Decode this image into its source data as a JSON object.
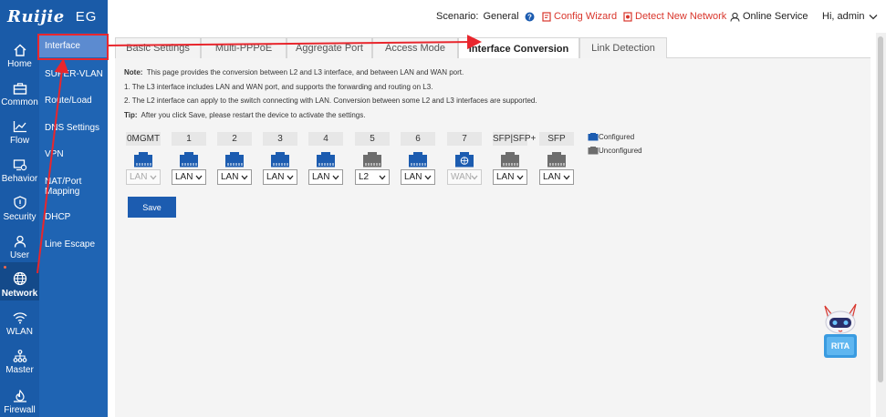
{
  "app": {
    "brand": "Ruijie",
    "product": "EG"
  },
  "topbar": {
    "scenario_label": "Scenario:",
    "scenario_value": "General",
    "config_wizard": "Config Wizard",
    "detect_network": "Detect New Network",
    "online_service": "Online Service",
    "user_greeting": "Hi, admin"
  },
  "nav": [
    {
      "label": "Home",
      "icon": "home-icon"
    },
    {
      "label": "Common",
      "icon": "briefcase-icon"
    },
    {
      "label": "Flow",
      "icon": "flow-chart-icon"
    },
    {
      "label": "Behavior",
      "icon": "behavior-icon"
    },
    {
      "label": "Security",
      "icon": "shield-icon"
    },
    {
      "label": "User",
      "icon": "user-icon"
    },
    {
      "label": "Network",
      "icon": "globe-icon"
    },
    {
      "label": "WLAN",
      "icon": "wifi-icon"
    },
    {
      "label": "Master",
      "icon": "hierarchy-icon"
    },
    {
      "label": "Firewall",
      "icon": "firewall-icon"
    }
  ],
  "subnav": [
    {
      "label": "Interface"
    },
    {
      "label": "SUPER-VLAN"
    },
    {
      "label": "Route/Load"
    },
    {
      "label": "DNS Settings"
    },
    {
      "label": "VPN"
    },
    {
      "label": "NAT/Port Mapping"
    },
    {
      "label": "DHCP"
    },
    {
      "label": "Line Escape"
    }
  ],
  "tabs": [
    {
      "label": "Basic Settings"
    },
    {
      "label": "Multi-PPPoE"
    },
    {
      "label": "Aggregate Port"
    },
    {
      "label": "Access Mode"
    },
    {
      "label": "Interface Conversion"
    },
    {
      "label": "Link Detection"
    }
  ],
  "note": {
    "line1_bold": "Note:",
    "line1": "This page provides the conversion between L2 and L3 interface, and between LAN and WAN port.",
    "line2": "1. The L3 interface includes LAN and WAN port, and supports the forwarding and routing on L3.",
    "line3": "2. The L2 interface can apply to the switch connecting with LAN. Conversion between some L2 and L3 interfaces are supported.",
    "line4_bold": "Tip:",
    "line4": "After you click Save, please restart the device to activate the settings."
  },
  "ports": [
    {
      "name": "0MGMT",
      "value": "LAN",
      "status": "configured",
      "disabled": true
    },
    {
      "name": "1",
      "value": "LAN",
      "status": "configured",
      "disabled": false
    },
    {
      "name": "2",
      "value": "LAN",
      "status": "configured",
      "disabled": false
    },
    {
      "name": "3",
      "value": "LAN",
      "status": "configured",
      "disabled": false
    },
    {
      "name": "4",
      "value": "LAN",
      "status": "configured",
      "disabled": false
    },
    {
      "name": "5",
      "value": "L2",
      "status": "unconfigured",
      "disabled": false
    },
    {
      "name": "6",
      "value": "LAN",
      "status": "configured",
      "disabled": false
    },
    {
      "name": "7",
      "value": "WAN",
      "status": "configured",
      "disabled": true
    },
    {
      "name": "SFP|SFP+",
      "value": "LAN",
      "status": "unconfigured",
      "disabled": false
    },
    {
      "name": "SFP",
      "value": "LAN",
      "status": "unconfigured",
      "disabled": false
    }
  ],
  "legend": {
    "configured": "Configured",
    "unconfigured": "Unconfigured"
  },
  "save_label": "Save",
  "assistant": {
    "label": "RITA"
  },
  "colors": {
    "sidebar": "#1a5ba8",
    "subnav": "#1f64b3",
    "accent": "#1c5cb0",
    "red": "#d9362c",
    "annotation": "#e8262d"
  }
}
